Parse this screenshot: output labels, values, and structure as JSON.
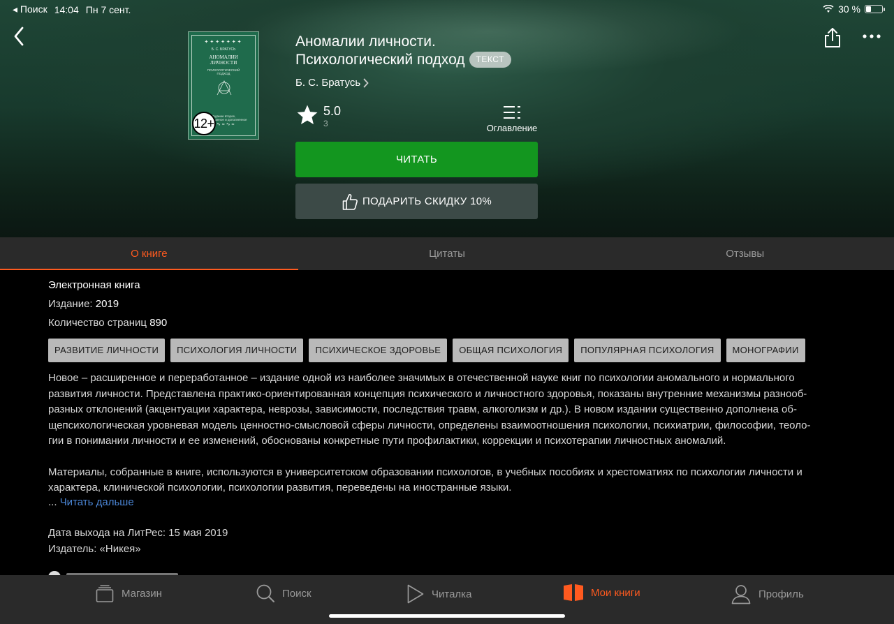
{
  "status_bar": {
    "back_label": "◂ Поиск",
    "time": "14:04",
    "date": "Пн 7 сент.",
    "battery": "30 %",
    "battery_level": 0.3
  },
  "book": {
    "title_line1": "Аномалии личности.",
    "title_line2": "Психологический подход",
    "format_badge": "ТЕКСТ",
    "author": "Б. С. Братусь",
    "age_rating": "12+",
    "cover": {
      "author": "Б. С. БРАТУСЬ",
      "title_line1": "АНОМАЛИИ",
      "title_line2": "ЛИЧНОСТИ",
      "subtitle_line1": "ПСИХОЛОГИЧЕСКИЙ",
      "subtitle_line2": "ПОДХОД",
      "bottom_line1": "Издание второе,",
      "bottom_line2": "переработанное и дополненное"
    },
    "rating": "5.0",
    "rating_count": "3",
    "toc_label": "Оглавление"
  },
  "actions": {
    "read": "ЧИТАТЬ",
    "gift": "ПОДАРИТЬ СКИДКУ 10%"
  },
  "tabs": [
    {
      "label": "О книге",
      "active": true
    },
    {
      "label": "Цитаты",
      "active": false
    },
    {
      "label": "Отзывы",
      "active": false
    }
  ],
  "details": {
    "type": "Электронная книга",
    "edition_label": "Издание:",
    "edition_value": "2019",
    "pages_label": "Количество страниц",
    "pages_value": "890"
  },
  "genres": [
    "РАЗВИТИЕ ЛИЧНОСТИ",
    "ПСИХОЛОГИЯ ЛИЧНОСТИ",
    "ПСИХИЧЕСКОЕ ЗДОРОВЬЕ",
    "ОБЩАЯ ПСИХОЛОГИЯ",
    "ПОПУЛЯРНАЯ ПСИХОЛОГИЯ",
    "МОНОГРАФИИ"
  ],
  "description": {
    "paragraph1_lines": [
      "Новое – расширенное и переработанное – издание одной из наиболее значимых в отечественной науке книг по психологии аномального и нормального",
      "развития личности. Представлена практико-ориентированная концепция психического и личностного здоровья, показаны внутренние механизмы разнооб-",
      "разных отклонений (акцентуации характера, неврозы, зависимости, последствия травм, алкоголизм и др.). В новом издании существенно дополнена об-",
      "щепсихологическая уровневая модель ценностно-смысловой сферы личности, определены взаимоотношения психологии, психиатрии, философии, теоло-",
      "гии в понимании личности и ее изменений, обоснованы конкретные пути профилактики, коррекции и психотерапии личностных аномалий."
    ],
    "paragraph2_lines": [
      "Материалы, собранные в книге, используются в университетском образовании психологов, в учебных пособиях и хрестоматиях по психологии личности и",
      "характера, клинической психологии, психологии развития, переведены на иностранные языки."
    ],
    "ellipsis": "...",
    "read_more": "Читать дальше",
    "link_color": "#4b86d6"
  },
  "release": {
    "date_line": "Дата выхода на ЛитРес: 15 мая 2019",
    "publisher_line": "Издатель: «Никея»"
  },
  "bottom_nav": [
    {
      "label": "Магазин",
      "icon": "store-icon",
      "active": false
    },
    {
      "label": "Поиск",
      "icon": "search-icon",
      "active": false
    },
    {
      "label": "Читалка",
      "icon": "play-icon",
      "active": false
    },
    {
      "label": "Мои книги",
      "icon": "open-book-icon",
      "active": true
    },
    {
      "label": "Профиль",
      "icon": "profile-icon",
      "active": false
    }
  ],
  "colors": {
    "accent": "#ff5a1f",
    "read_button": "#13961f",
    "gift_button": "#3c4a47"
  }
}
